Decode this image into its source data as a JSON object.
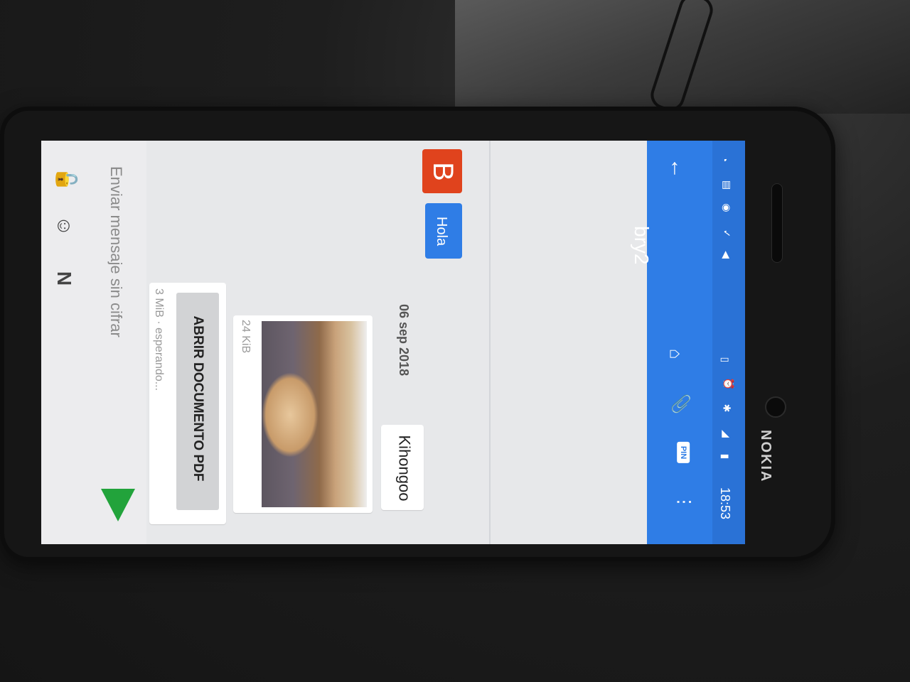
{
  "status_bar": {
    "time": "18:53",
    "icons": [
      "wifi-question-icon",
      "sim-icon",
      "whatsapp-icon",
      "check-icon",
      "send-location-icon",
      "vibrate-icon",
      "alarm-icon",
      "bluetooth-icon",
      "signal-icon",
      "battery-icon"
    ]
  },
  "appbar": {
    "title": "bry2",
    "back_icon": "←",
    "tools": [
      {
        "name": "home-icon",
        "glyph": "⌂"
      },
      {
        "name": "attach-icon",
        "glyph": "📎"
      },
      {
        "name": "pin-icon",
        "label": "PIN"
      },
      {
        "name": "overflow-icon",
        "glyph": "⋮"
      }
    ],
    "accent": "#2f7de6"
  },
  "messages": {
    "avatar_letter": "B",
    "hola": "Hola",
    "date": "06 sep 2018",
    "kihongoo": "Kihongoo",
    "photo_size": "24 KiB",
    "pdf_button": "ABRIR DOCUMENTO PDF",
    "pdf_meta": "3 MiB · esperando..."
  },
  "input": {
    "placeholder": "Enviar mensaje sin cifrar",
    "lock_icon": "🔓",
    "emoji_icon": "☺",
    "keyboard_label": "N"
  },
  "device": {
    "brand": "NOKIA"
  }
}
